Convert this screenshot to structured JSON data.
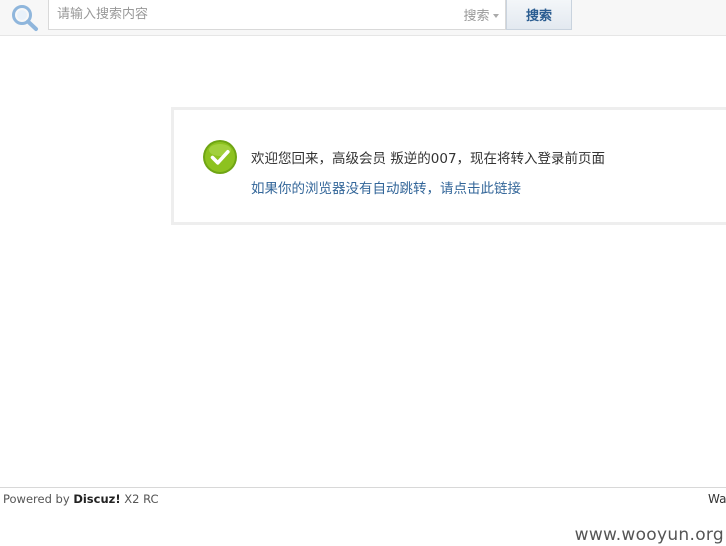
{
  "header": {
    "search": {
      "placeholder": "请输入搜索内容",
      "value": "",
      "type_label": "搜索",
      "button_label": "搜索"
    }
  },
  "message": {
    "text": "欢迎您回来，高级会员 叛逆的007，现在将转入登录前页面",
    "link_text": "如果你的浏览器没有自动跳转，请点击此链接"
  },
  "footer": {
    "powered_by": "Powered by",
    "brand": "Discuz!",
    "version": "X2 RC",
    "right_text": "Wa"
  },
  "watermark": "www.wooyun.org",
  "colors": {
    "link": "#336699",
    "button_text": "#2b5d91",
    "success_green": "#8dc21f"
  },
  "icons": {
    "search": "search-icon",
    "success": "check-icon"
  }
}
